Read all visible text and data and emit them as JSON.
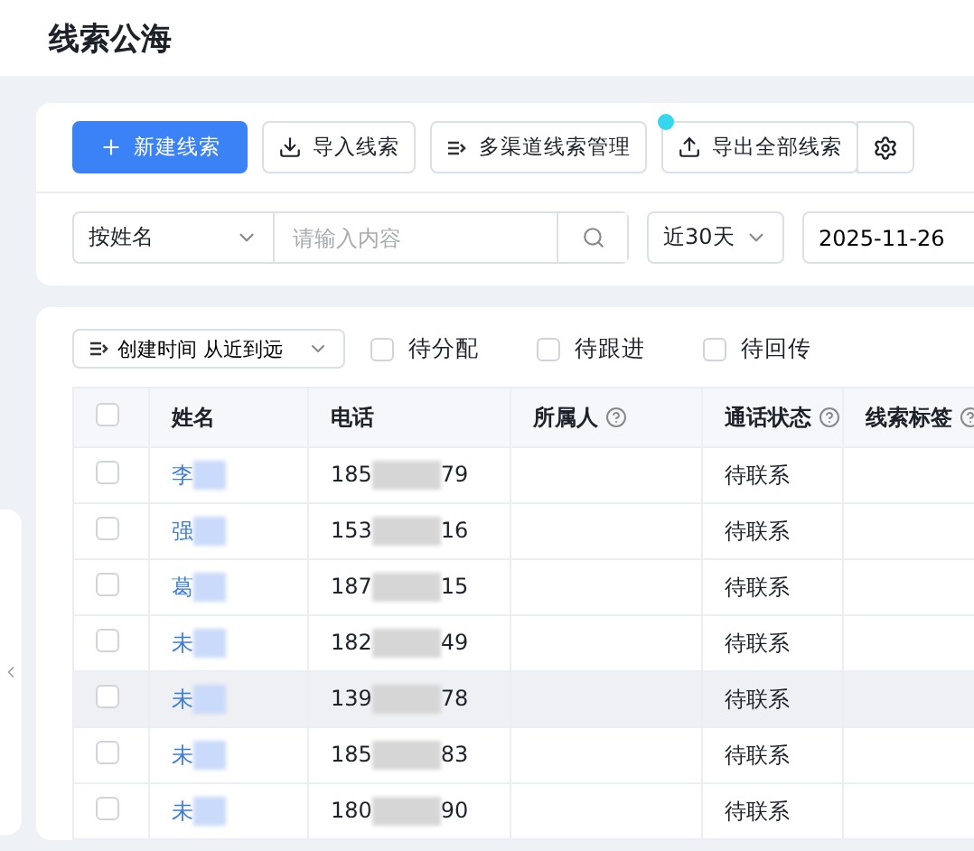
{
  "page": {
    "title": "线索公海"
  },
  "toolbar": {
    "buttons": [
      {
        "kind": "new",
        "label": "新建线索"
      },
      {
        "kind": "import",
        "label": "导入线索"
      },
      {
        "kind": "channels",
        "label": "多渠道线索管理"
      },
      {
        "kind": "export",
        "label": "导出全部线索"
      },
      {
        "kind": "settings"
      }
    ]
  },
  "search": {
    "field": "按姓名",
    "placeholder": "请输入内容",
    "range": "近30天",
    "date": "2025-11-26"
  },
  "sort": {
    "label": "创建时间 从近到远"
  },
  "filters": [
    {
      "label": "待分配",
      "checked": false
    },
    {
      "label": "待跟进",
      "checked": false
    },
    {
      "label": "待回传",
      "checked": false
    }
  ],
  "table": {
    "all_checked": false,
    "columns": [
      {
        "label": "姓名",
        "help": false
      },
      {
        "label": "电话",
        "help": false
      },
      {
        "label": "所属人",
        "help": true
      },
      {
        "label": "通话状态",
        "help": true
      },
      {
        "label": "线索标签",
        "help": true
      }
    ],
    "rows": [
      {
        "name": "李",
        "phone_start": "185",
        "phone_end": "79",
        "status": "待联系",
        "checked": false,
        "highlighted": false
      },
      {
        "name": "强",
        "phone_start": "153",
        "phone_end": "16",
        "status": "待联系",
        "checked": false,
        "highlighted": false
      },
      {
        "name": "葛",
        "phone_start": "187",
        "phone_end": "15",
        "status": "待联系",
        "checked": false,
        "highlighted": false
      },
      {
        "name": "未",
        "phone_start": "182",
        "phone_end": "49",
        "status": "待联系",
        "checked": false,
        "highlighted": false
      },
      {
        "name": "未",
        "phone_start": "139",
        "phone_end": "78",
        "status": "待联系",
        "checked": false,
        "highlighted": true
      },
      {
        "name": "未",
        "phone_start": "185",
        "phone_end": "83",
        "status": "待联系",
        "checked": false,
        "highlighted": false
      },
      {
        "name": "未",
        "phone_start": "180",
        "phone_end": "90",
        "status": "待联系",
        "checked": false,
        "highlighted": false
      }
    ]
  }
}
